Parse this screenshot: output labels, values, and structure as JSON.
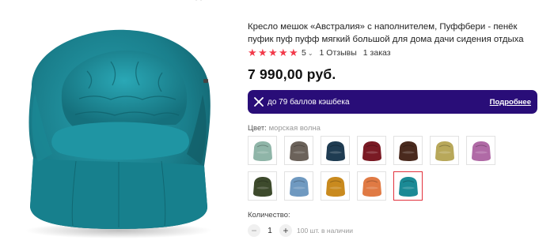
{
  "product": {
    "title": "Кресло мешок «Австралия» с наполнителем, Пуффбери - пенёк пуфик пуф пуфф мягкий большой для дома дачи сидения отдыха",
    "rating": {
      "stars_filled": 5,
      "stars_total": 5,
      "value": "5",
      "reviews": "1 Отзывы",
      "orders": "1 заказ"
    },
    "price": "7 990,00 руб.",
    "cashback": {
      "text": "до 79 баллов кэшбека",
      "more_link": "Подробнее",
      "background": "#290d78"
    },
    "color": {
      "label": "Цвет:",
      "value": "морская волна"
    },
    "swatches": [
      {
        "color": "#8fb5a8",
        "selected": false
      },
      {
        "color": "#6b625a",
        "selected": false
      },
      {
        "color": "#1f3c52",
        "selected": false
      },
      {
        "color": "#7a1a24",
        "selected": false
      },
      {
        "color": "#4a2a1e",
        "selected": false
      },
      {
        "color": "#b8a85a",
        "selected": false
      },
      {
        "color": "#b06aa6",
        "selected": false
      },
      {
        "color": "#3d4a2c",
        "selected": false
      },
      {
        "color": "#6f99c0",
        "selected": false
      },
      {
        "color": "#c98a1e",
        "selected": false
      },
      {
        "color": "#e07a44",
        "selected": false
      },
      {
        "color": "#1b8a95",
        "selected": true
      }
    ],
    "quantity": {
      "label": "Количество:",
      "value": "1",
      "minus": "−",
      "plus": "+",
      "stock": "100 шт. в наличии"
    },
    "image": {
      "chair_color": "#1d8290"
    }
  },
  "colors": {
    "star": "#f23a4a",
    "selected_border": "#e2323d"
  },
  "icons": {
    "star": "star-icon",
    "chevron": "chevron-down-icon",
    "cashback": "cashback-icon"
  }
}
